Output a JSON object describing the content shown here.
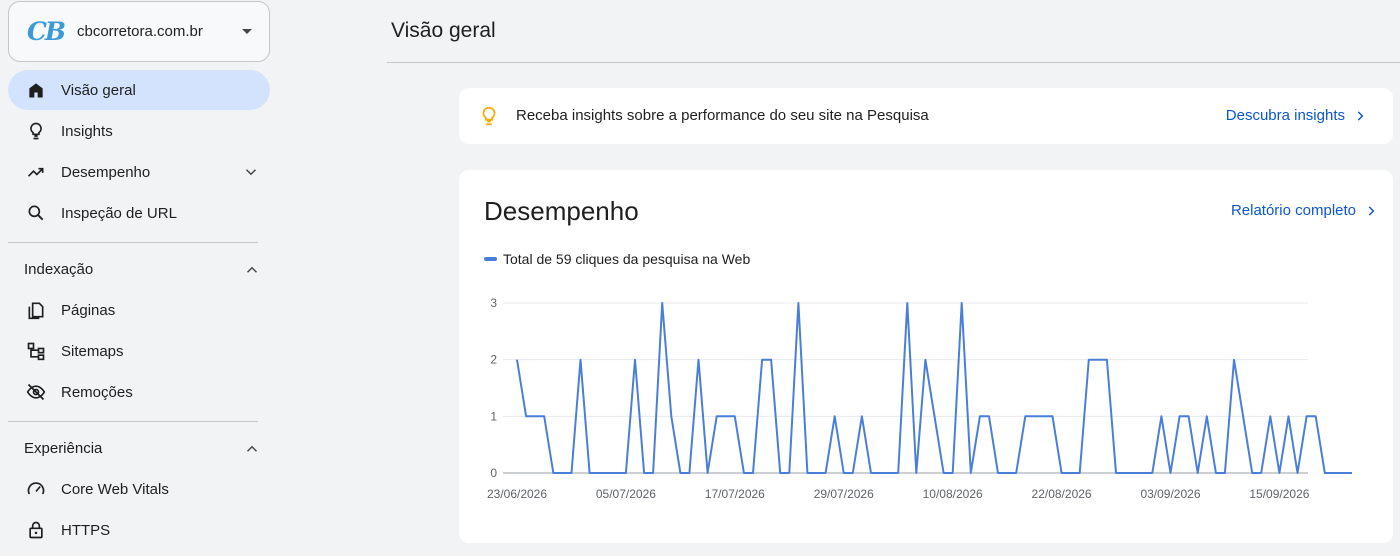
{
  "property": {
    "logo_text": "CB",
    "name": "cbcorretora.com.br"
  },
  "sidebar": {
    "items": [
      {
        "label": "Visão geral",
        "icon": "home-icon"
      },
      {
        "label": "Insights",
        "icon": "lightbulb-icon"
      },
      {
        "label": "Desempenho",
        "icon": "trending-up-icon"
      },
      {
        "label": "Inspeção de URL",
        "icon": "search-icon"
      }
    ],
    "indexing": {
      "title": "Indexação",
      "items": [
        {
          "label": "Páginas",
          "icon": "pages-icon"
        },
        {
          "label": "Sitemaps",
          "icon": "sitemap-icon"
        },
        {
          "label": "Remoções",
          "icon": "eye-off-icon"
        }
      ]
    },
    "experience": {
      "title": "Experiência",
      "items": [
        {
          "label": "Core Web Vitals",
          "icon": "gauge-icon"
        },
        {
          "label": "HTTPS",
          "icon": "lock-icon"
        }
      ]
    }
  },
  "header": {
    "title": "Visão geral"
  },
  "insights_banner": {
    "text": "Receba insights sobre a performance do seu site na Pesquisa",
    "link": "Descubra insights"
  },
  "performance": {
    "title": "Desempenho",
    "link": "Relatório completo",
    "legend": "Total de 59 cliques da pesquisa na Web"
  },
  "colors": {
    "accent": "#0b57d0",
    "line": "#4a7fd9",
    "active_nav": "#d3e3fd",
    "bulb": "#f9ab00"
  },
  "chart_data": {
    "type": "line",
    "series": [
      {
        "name": "Total de 59 cliques da pesquisa na Web",
        "values": [
          2,
          1,
          1,
          1,
          0,
          0,
          0,
          2,
          0,
          0,
          0,
          0,
          0,
          2,
          0,
          0,
          3,
          1,
          0,
          0,
          2,
          0,
          1,
          1,
          1,
          0,
          0,
          2,
          2,
          0,
          0,
          3,
          0,
          0,
          0,
          1,
          0,
          0,
          1,
          0,
          0,
          0,
          0,
          3,
          0,
          2,
          1,
          0,
          0,
          3,
          0,
          1,
          1,
          0,
          0,
          0,
          1,
          1,
          1,
          1,
          0,
          0,
          0,
          2,
          2,
          2,
          0,
          0,
          0,
          0,
          0,
          1,
          0,
          1,
          1,
          0,
          1,
          0,
          0,
          2,
          1,
          0,
          0,
          1,
          0,
          1,
          0,
          1,
          1,
          0,
          0,
          0,
          0
        ]
      }
    ],
    "x_tick_labels": [
      "23/06/2026",
      "05/07/2026",
      "17/07/2026",
      "29/07/2026",
      "10/08/2026",
      "22/08/2026",
      "03/09/2026",
      "15/09/2026"
    ],
    "x_tick_index": [
      0,
      12,
      24,
      36,
      48,
      60,
      72,
      84
    ],
    "y_ticks": [
      0,
      1,
      2,
      3
    ],
    "ylim": [
      0,
      3
    ],
    "grid": true
  }
}
